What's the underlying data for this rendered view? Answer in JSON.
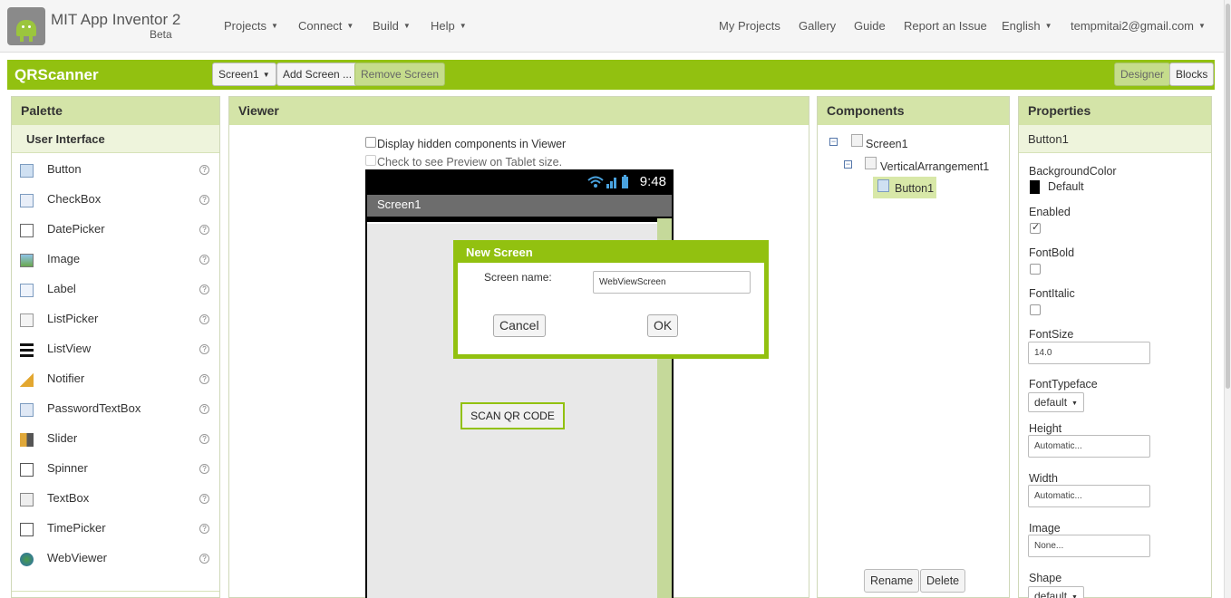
{
  "header": {
    "app_title": "MIT App Inventor 2",
    "app_subtitle": "Beta",
    "menus_left": [
      "Projects",
      "Connect",
      "Build",
      "Help"
    ],
    "links_right": [
      "My Projects",
      "Gallery",
      "Guide",
      "Report an Issue"
    ],
    "language": "English",
    "account": "tempmitai2@gmail.com"
  },
  "project": {
    "name": "QRScanner",
    "screen_select": "Screen1",
    "add_screen": "Add Screen ...",
    "remove_screen": "Remove Screen",
    "designer": "Designer",
    "blocks": "Blocks"
  },
  "palette": {
    "title": "Palette",
    "category": "User Interface",
    "help_glyph": "?",
    "items": [
      {
        "label": "Button",
        "icon": "button-icon"
      },
      {
        "label": "CheckBox",
        "icon": "checkbox-icon"
      },
      {
        "label": "DatePicker",
        "icon": "datepicker-icon"
      },
      {
        "label": "Image",
        "icon": "image-icon"
      },
      {
        "label": "Label",
        "icon": "label-icon"
      },
      {
        "label": "ListPicker",
        "icon": "listpicker-icon"
      },
      {
        "label": "ListView",
        "icon": "listview-icon"
      },
      {
        "label": "Notifier",
        "icon": "notifier-icon"
      },
      {
        "label": "PasswordTextBox",
        "icon": "password-icon"
      },
      {
        "label": "Slider",
        "icon": "slider-icon"
      },
      {
        "label": "Spinner",
        "icon": "spinner-icon"
      },
      {
        "label": "TextBox",
        "icon": "textbox-icon"
      },
      {
        "label": "TimePicker",
        "icon": "timepicker-icon"
      },
      {
        "label": "WebViewer",
        "icon": "webviewer-icon"
      }
    ]
  },
  "viewer": {
    "title": "Viewer",
    "hidden_components_label": "Display hidden components in Viewer",
    "tablet_preview_label": "Check to see Preview on Tablet size.",
    "phone_time": "9:48",
    "screen_title": "Screen1",
    "scan_button": "SCAN QR CODE"
  },
  "dialog": {
    "title": "New Screen",
    "field_label": "Screen name:",
    "field_value": "WebViewScreen",
    "cancel": "Cancel",
    "ok": "OK"
  },
  "components": {
    "title": "Components",
    "toggle_glyph": "−",
    "tree": [
      "Screen1",
      "VerticalArrangement1",
      "Button1"
    ],
    "rename": "Rename",
    "delete": "Delete"
  },
  "properties": {
    "title": "Properties",
    "selected": "Button1",
    "background_color_label": "BackgroundColor",
    "background_color_value": "Default",
    "enabled_label": "Enabled",
    "enabled": true,
    "fontbold_label": "FontBold",
    "fontbold": false,
    "fontitalic_label": "FontItalic",
    "fontitalic": false,
    "fontsize_label": "FontSize",
    "fontsize_value": "14.0",
    "fonttypeface_label": "FontTypeface",
    "fonttypeface_value": "default",
    "height_label": "Height",
    "height_value": "Automatic...",
    "width_label": "Width",
    "width_value": "Automatic...",
    "image_label": "Image",
    "image_value": "None...",
    "shape_label": "Shape",
    "shape_value": "default"
  },
  "colors": {
    "accent": "#92c110",
    "panel_header": "#d4e4a8",
    "selection": "#d8e8a8"
  }
}
